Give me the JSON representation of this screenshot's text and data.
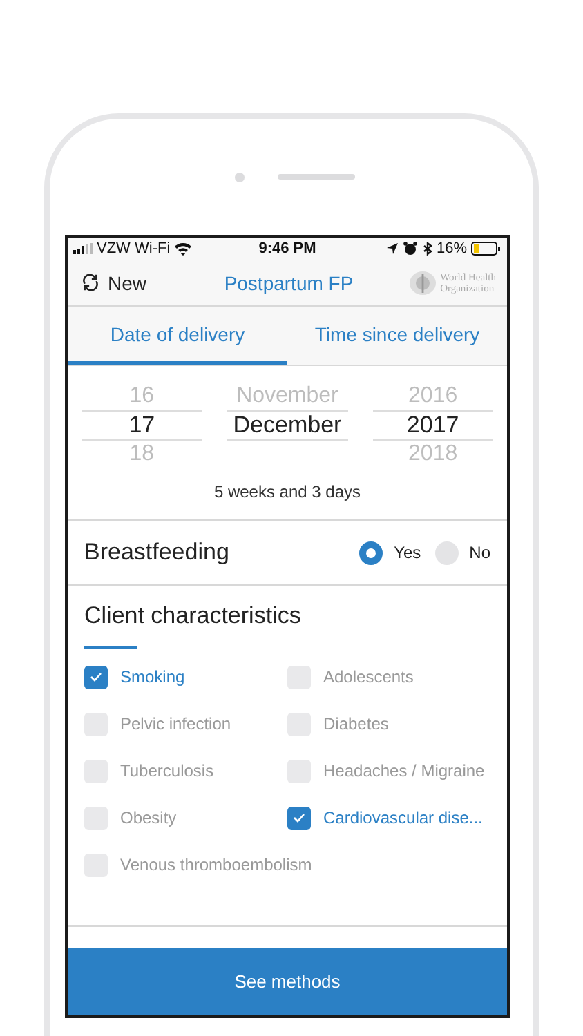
{
  "status_bar": {
    "carrier": "VZW Wi-Fi",
    "time": "9:46 PM",
    "battery": "16%"
  },
  "nav": {
    "left_button": "New",
    "title": "Postpartum FP",
    "logo_text": [
      "World Health",
      "Organization"
    ]
  },
  "tabs": [
    {
      "label": "Date of delivery",
      "selected": true
    },
    {
      "label": "Time since delivery",
      "selected": false
    }
  ],
  "date_picker": {
    "columns": [
      {
        "items": [
          {
            "text": "16",
            "selected": false
          },
          {
            "text": "17",
            "selected": true
          },
          {
            "text": "18",
            "selected": false
          }
        ]
      },
      {
        "items": [
          {
            "text": "November",
            "selected": false
          },
          {
            "text": "December",
            "selected": true
          }
        ]
      },
      {
        "items": [
          {
            "text": "2016",
            "selected": false
          },
          {
            "text": "2017",
            "selected": true
          },
          {
            "text": "2018",
            "selected": false
          }
        ]
      }
    ],
    "duration": "5 weeks and 3 days"
  },
  "breastfeeding": {
    "label": "Breastfeeding",
    "options": [
      {
        "label": "Yes",
        "selected": true
      },
      {
        "label": "No",
        "selected": false
      }
    ]
  },
  "client_characteristics": {
    "title": "Client characteristics",
    "items": [
      {
        "label": "Smoking",
        "checked": true
      },
      {
        "label": "Adolescents",
        "checked": false
      },
      {
        "label": "Pelvic infection",
        "checked": false
      },
      {
        "label": "Diabetes",
        "checked": false
      },
      {
        "label": "Tuberculosis",
        "checked": false
      },
      {
        "label": "Headaches / Migraine",
        "checked": false
      },
      {
        "label": "Obesity",
        "checked": false
      },
      {
        "label": "Cardiovascular dise...",
        "checked": true
      },
      {
        "label": "Venous thromboembolism",
        "checked": false
      }
    ]
  },
  "primary_button": "See methods"
}
